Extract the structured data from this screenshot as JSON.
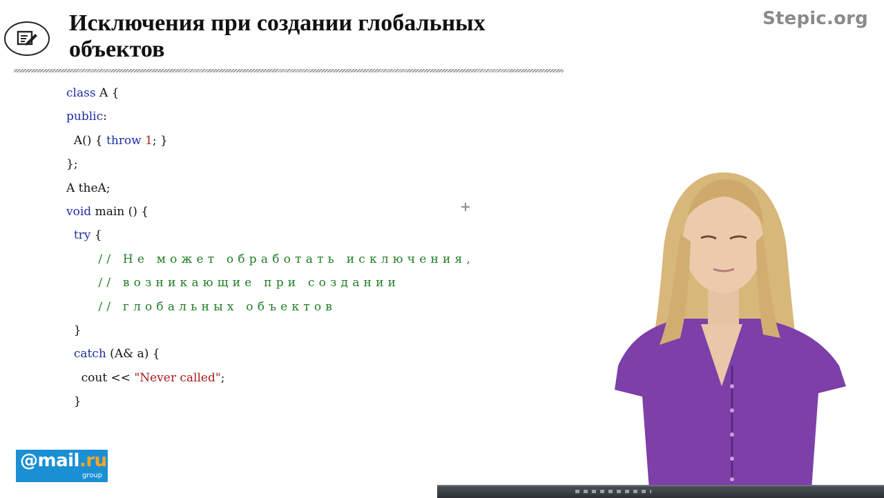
{
  "header": {
    "title": "Исключения при создании глобальных объектов",
    "brand": "Stepic.org",
    "icon": "edit-note-icon"
  },
  "code": {
    "lines": [
      "class A {",
      "public:",
      "  A() { throw 1; }",
      "};",
      "A theA;",
      "void main () {",
      "  try {",
      "    // Не может обработать исключения,",
      "    // возникающие при создании",
      "    // глобальных объектов",
      "  }",
      "  catch (A& a) {",
      "    cout << \"Never called\";",
      "  }"
    ]
  },
  "logo": {
    "main": "@mail",
    "dot_ru": ".ru",
    "sub": "group"
  },
  "colors": {
    "keyword": "#1d2ea3",
    "number": "#a81b1b",
    "string": "#a81b1b",
    "comment": "#1e7d23",
    "mail_blue": "#1a8fd4",
    "mail_orange": "#ffa621"
  }
}
